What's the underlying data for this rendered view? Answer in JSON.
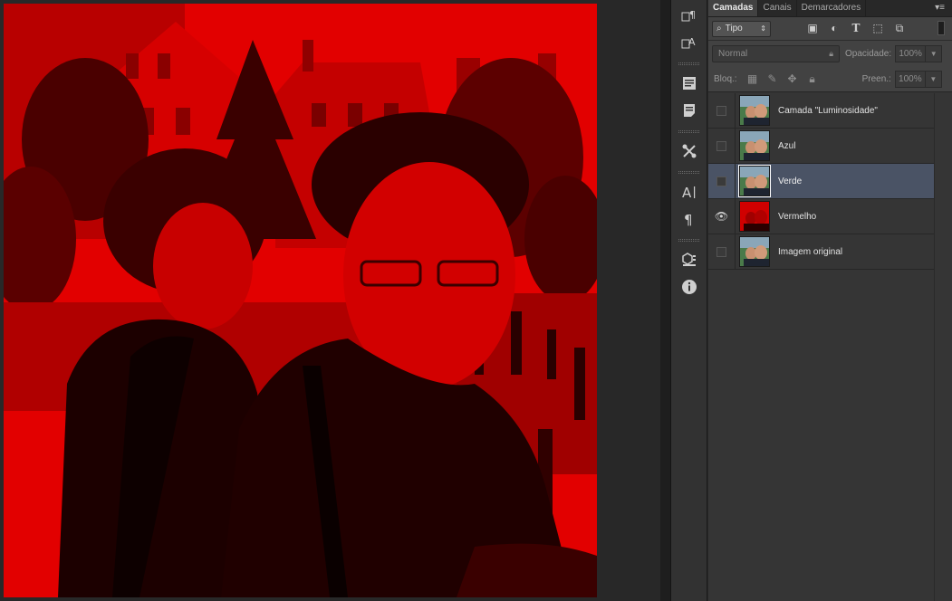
{
  "canvas": {
    "image_description": "Red channel view of photo with two men",
    "tint_color": "#d40000"
  },
  "tool_strip": {
    "tools": [
      {
        "name": "paragraph-style-icon"
      },
      {
        "name": "character-style-icon"
      },
      {
        "name": "notes-icon"
      },
      {
        "name": "document-icon"
      },
      {
        "name": "tools-icon"
      },
      {
        "name": "character-icon"
      },
      {
        "name": "paragraph-icon"
      },
      {
        "name": "3d-icon"
      },
      {
        "name": "info-icon"
      }
    ]
  },
  "panel": {
    "tabs": [
      {
        "label": "Camadas",
        "active": true
      },
      {
        "label": "Canais",
        "active": false
      },
      {
        "label": "Demarcadores",
        "active": false
      }
    ],
    "menu_glyph": "▾≡",
    "filter": {
      "kind_label": "Tipo",
      "icons": [
        "image-filter-icon",
        "adjustment-filter-icon",
        "type-filter-icon",
        "shape-filter-icon",
        "smart-object-filter-icon"
      ]
    },
    "blend_mode": "Normal",
    "opacity_label": "Opacidade:",
    "opacity_value": "100%",
    "lock_label": "Bloq.:",
    "fill_label": "Preen.:",
    "fill_value": "100%",
    "layers": [
      {
        "name": "Camada \"Luminosidade\"",
        "visible": false,
        "selected": false,
        "thumb": "color"
      },
      {
        "name": "Azul",
        "visible": false,
        "selected": false,
        "thumb": "color"
      },
      {
        "name": "Verde",
        "visible": false,
        "selected": true,
        "thumb": "color"
      },
      {
        "name": "Vermelho",
        "visible": true,
        "selected": false,
        "thumb": "red"
      },
      {
        "name": "Imagem original",
        "visible": false,
        "selected": false,
        "thumb": "color"
      }
    ]
  }
}
